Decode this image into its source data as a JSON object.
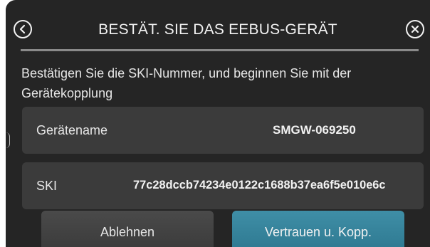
{
  "header": {
    "title": "BESTÄT. SIE DAS EEBUS-GERÄT",
    "back_icon": "chevron-left-circle-icon",
    "close_icon": "close-circle-icon"
  },
  "instruction": "Bestätigen Sie die SKI-Nummer, und beginnen Sie mit der Gerätekopplung",
  "device": {
    "name_label": "Gerätename",
    "name_value": "SMGW-069250",
    "ski_label": "SKI",
    "ski_value": "77c28dccb74234e0122c1688b37ea6f5e010e6c"
  },
  "actions": {
    "reject_label": "Ablehnen",
    "accept_label": "Vertrauen u. Kopp."
  },
  "colors": {
    "background": "#252525",
    "panel": "#3b3b3b",
    "accent": "#2d7890",
    "secondary_button": "#3a3a3a"
  }
}
